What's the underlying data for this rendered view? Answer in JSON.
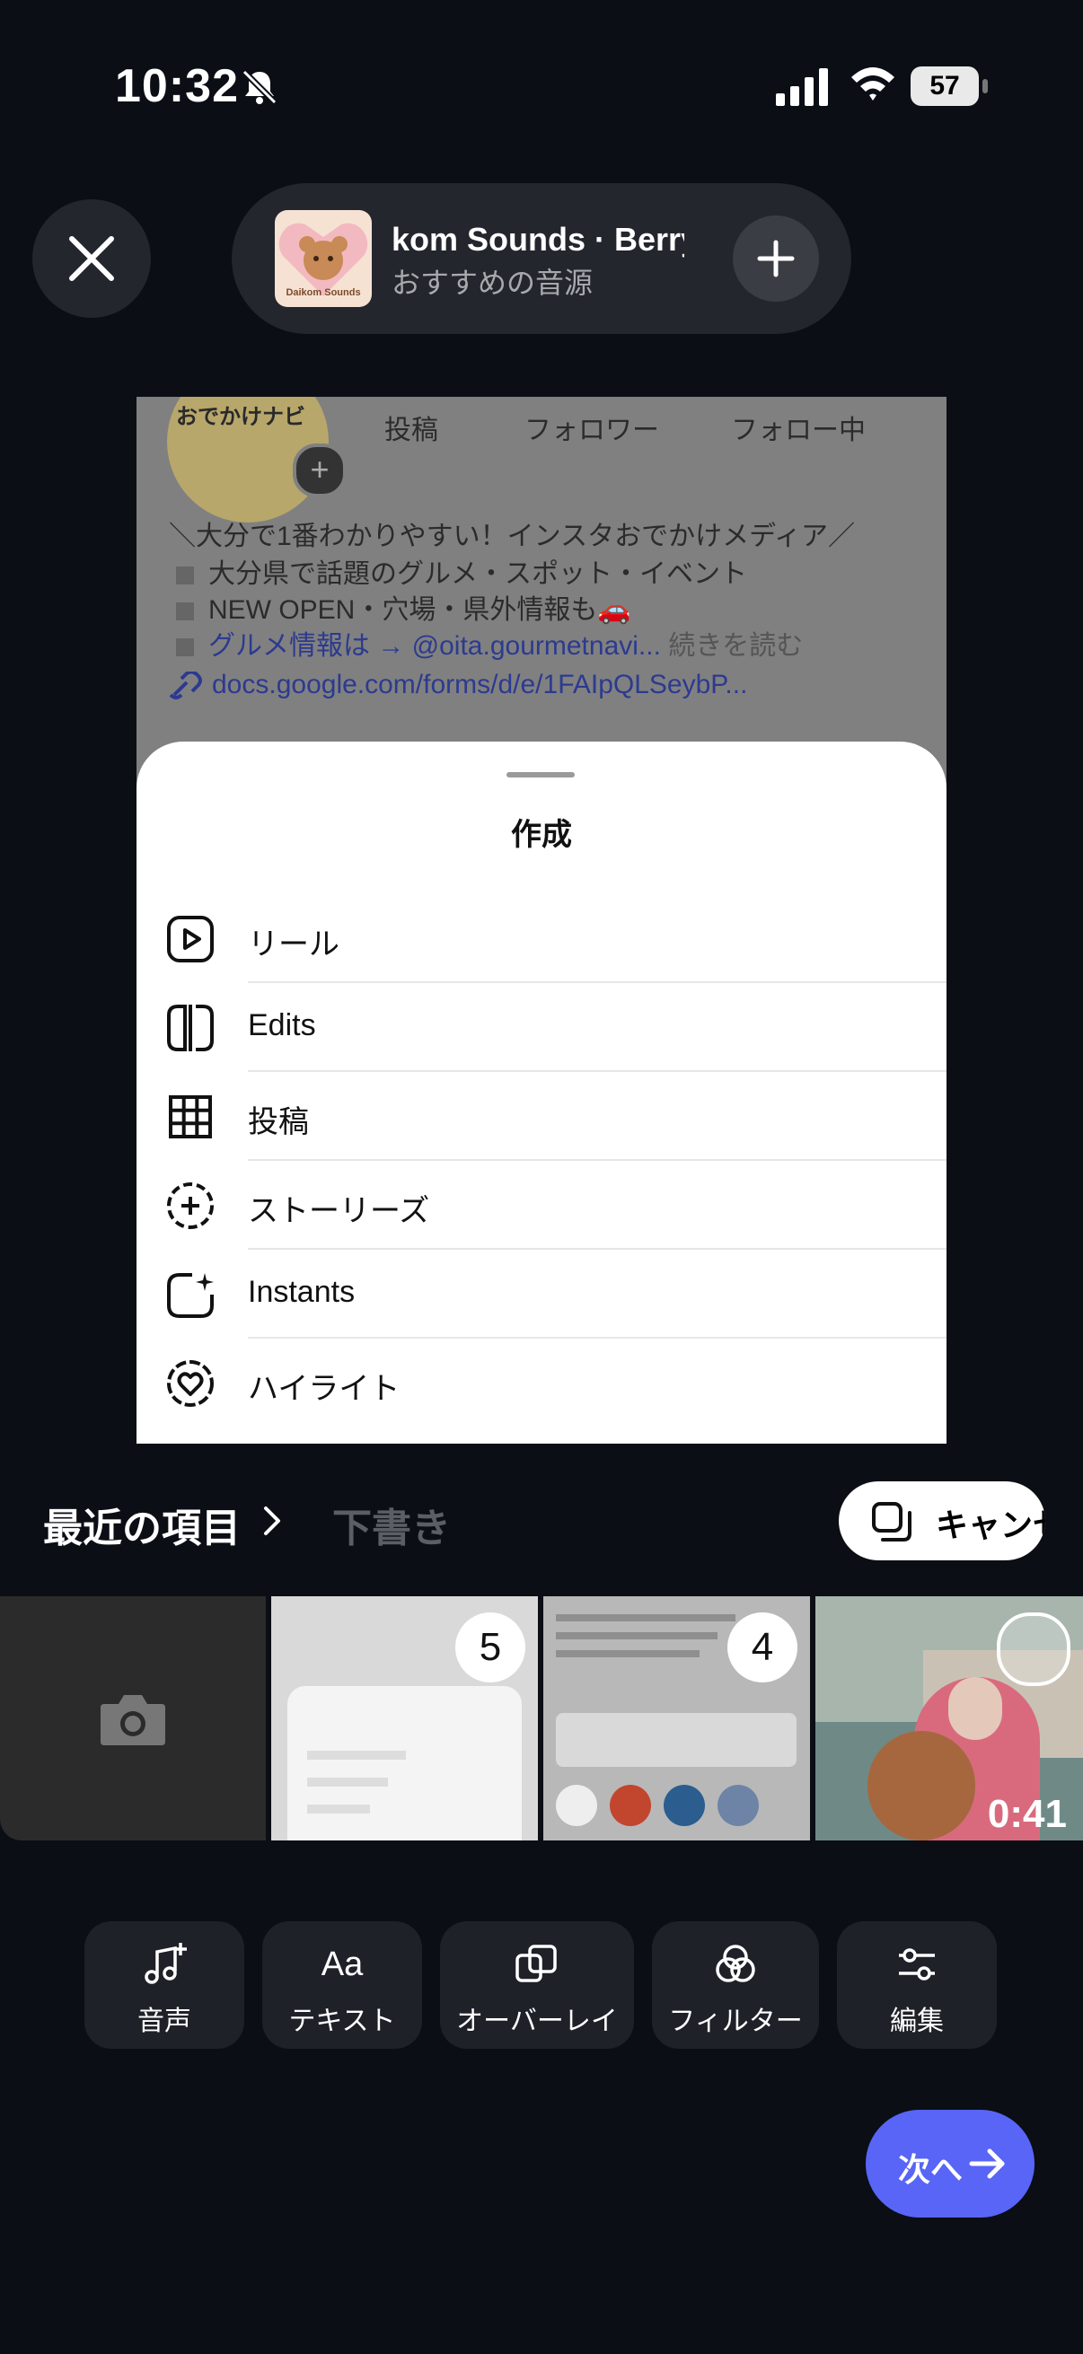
{
  "status_bar": {
    "time": "10:32",
    "battery": "57"
  },
  "sound": {
    "title": "kom Sounds · Berry",
    "subtitle": "おすすめの音源",
    "thumb_text": "Daikom Sounds"
  },
  "preview": {
    "avatar_title": "おでかけナビ",
    "stats": [
      {
        "label": "投稿"
      },
      {
        "label": "フォロワー"
      },
      {
        "label": "フォロー中"
      }
    ],
    "bio_lines": [
      "＼大分で1番わかりやすい！インスタおでかけメディア／",
      "大分県で話題のグルメ・スポット・イベント",
      "NEW OPEN・穴場・県外情報も🚗",
      "グルメ情報は → @oita.gourmetnavi...",
      "続きを読む",
      "docs.google.com/forms/d/e/1FAIpQLSeybP..."
    ],
    "sheet": {
      "title": "作成",
      "items": [
        {
          "label": "リール",
          "icon": "reel-icon"
        },
        {
          "label": "Edits",
          "icon": "edits-icon"
        },
        {
          "label": "投稿",
          "icon": "grid-icon"
        },
        {
          "label": "ストーリーズ",
          "icon": "story-add-icon"
        },
        {
          "label": "Instants",
          "icon": "instants-icon"
        },
        {
          "label": "ハイライト",
          "icon": "highlight-icon"
        }
      ]
    }
  },
  "gallery": {
    "recent_label": "最近の項目",
    "drafts_label": "下書き",
    "cancel_label": "キャンセル",
    "thumbs": [
      {
        "kind": "camera"
      },
      {
        "kind": "screenshot",
        "badge": "5"
      },
      {
        "kind": "screenshot",
        "badge": "4"
      },
      {
        "kind": "video",
        "duration": "0:41"
      }
    ]
  },
  "toolbar": {
    "audio": "音声",
    "text": "テキスト",
    "overlay": "オーバーレイ",
    "filter": "フィルター",
    "edit": "編集"
  },
  "next_label": "次へ",
  "colors": {
    "background": "#0b0e15",
    "accent": "#5865f7"
  }
}
